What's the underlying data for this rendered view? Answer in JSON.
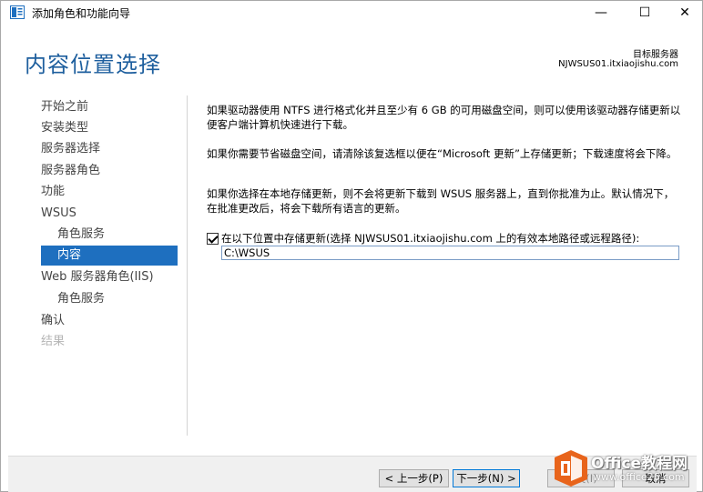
{
  "window": {
    "title": "添加角色和功能向导",
    "controls": {
      "minimize": "—",
      "maximize": "☐",
      "close": "✕"
    }
  },
  "header": {
    "page_title": "内容位置选择",
    "target_label": "目标服务器",
    "target_server": "NJWSUS01.itxiaojishu.com"
  },
  "nav": {
    "items": [
      {
        "label": "开始之前",
        "state": "normal",
        "level": 0
      },
      {
        "label": "安装类型",
        "state": "normal",
        "level": 0
      },
      {
        "label": "服务器选择",
        "state": "normal",
        "level": 0
      },
      {
        "label": "服务器角色",
        "state": "normal",
        "level": 0
      },
      {
        "label": "功能",
        "state": "normal",
        "level": 0
      },
      {
        "label": "WSUS",
        "state": "normal",
        "level": 0
      },
      {
        "label": "角色服务",
        "state": "normal",
        "level": 1
      },
      {
        "label": "内容",
        "state": "active",
        "level": 1
      },
      {
        "label": "Web 服务器角色(IIS)",
        "state": "normal",
        "level": 0
      },
      {
        "label": "角色服务",
        "state": "normal",
        "level": 1
      },
      {
        "label": "确认",
        "state": "normal",
        "level": 0
      },
      {
        "label": "结果",
        "state": "disabled",
        "level": 0
      }
    ]
  },
  "main": {
    "paragraph1": "如果驱动器使用 NTFS 进行格式化并且至少有 6 GB 的可用磁盘空间，则可以使用该驱动器存储更新以便客户端计算机快速进行下载。",
    "paragraph2": "如果你需要节省磁盘空间，请清除该复选框以便在“Microsoft 更新”上存储更新；下载速度将会下降。",
    "paragraph3": "如果你选择在本地存储更新，则不会将更新下载到 WSUS 服务器上，直到你批准为止。默认情况下，在批准更改后，将会下载所有语言的更新。",
    "checkbox_label": "在以下位置中存储更新(选择 NJWSUS01.itxiaojishu.com 上的有效本地路径或远程路径):",
    "checkbox_checked": true,
    "path_value": "C:\\WSUS"
  },
  "footer": {
    "prev_label": "< 上一步(P)",
    "next_label": "下一步(N) >",
    "install_label": "安装(I)",
    "cancel_label": "取消"
  },
  "watermark": {
    "title": "Office教程网",
    "url": "www.office26.com"
  },
  "colors": {
    "accent": "#1e6fbf",
    "title": "#1e5f9e",
    "watermark_orange": "#e8641b"
  }
}
